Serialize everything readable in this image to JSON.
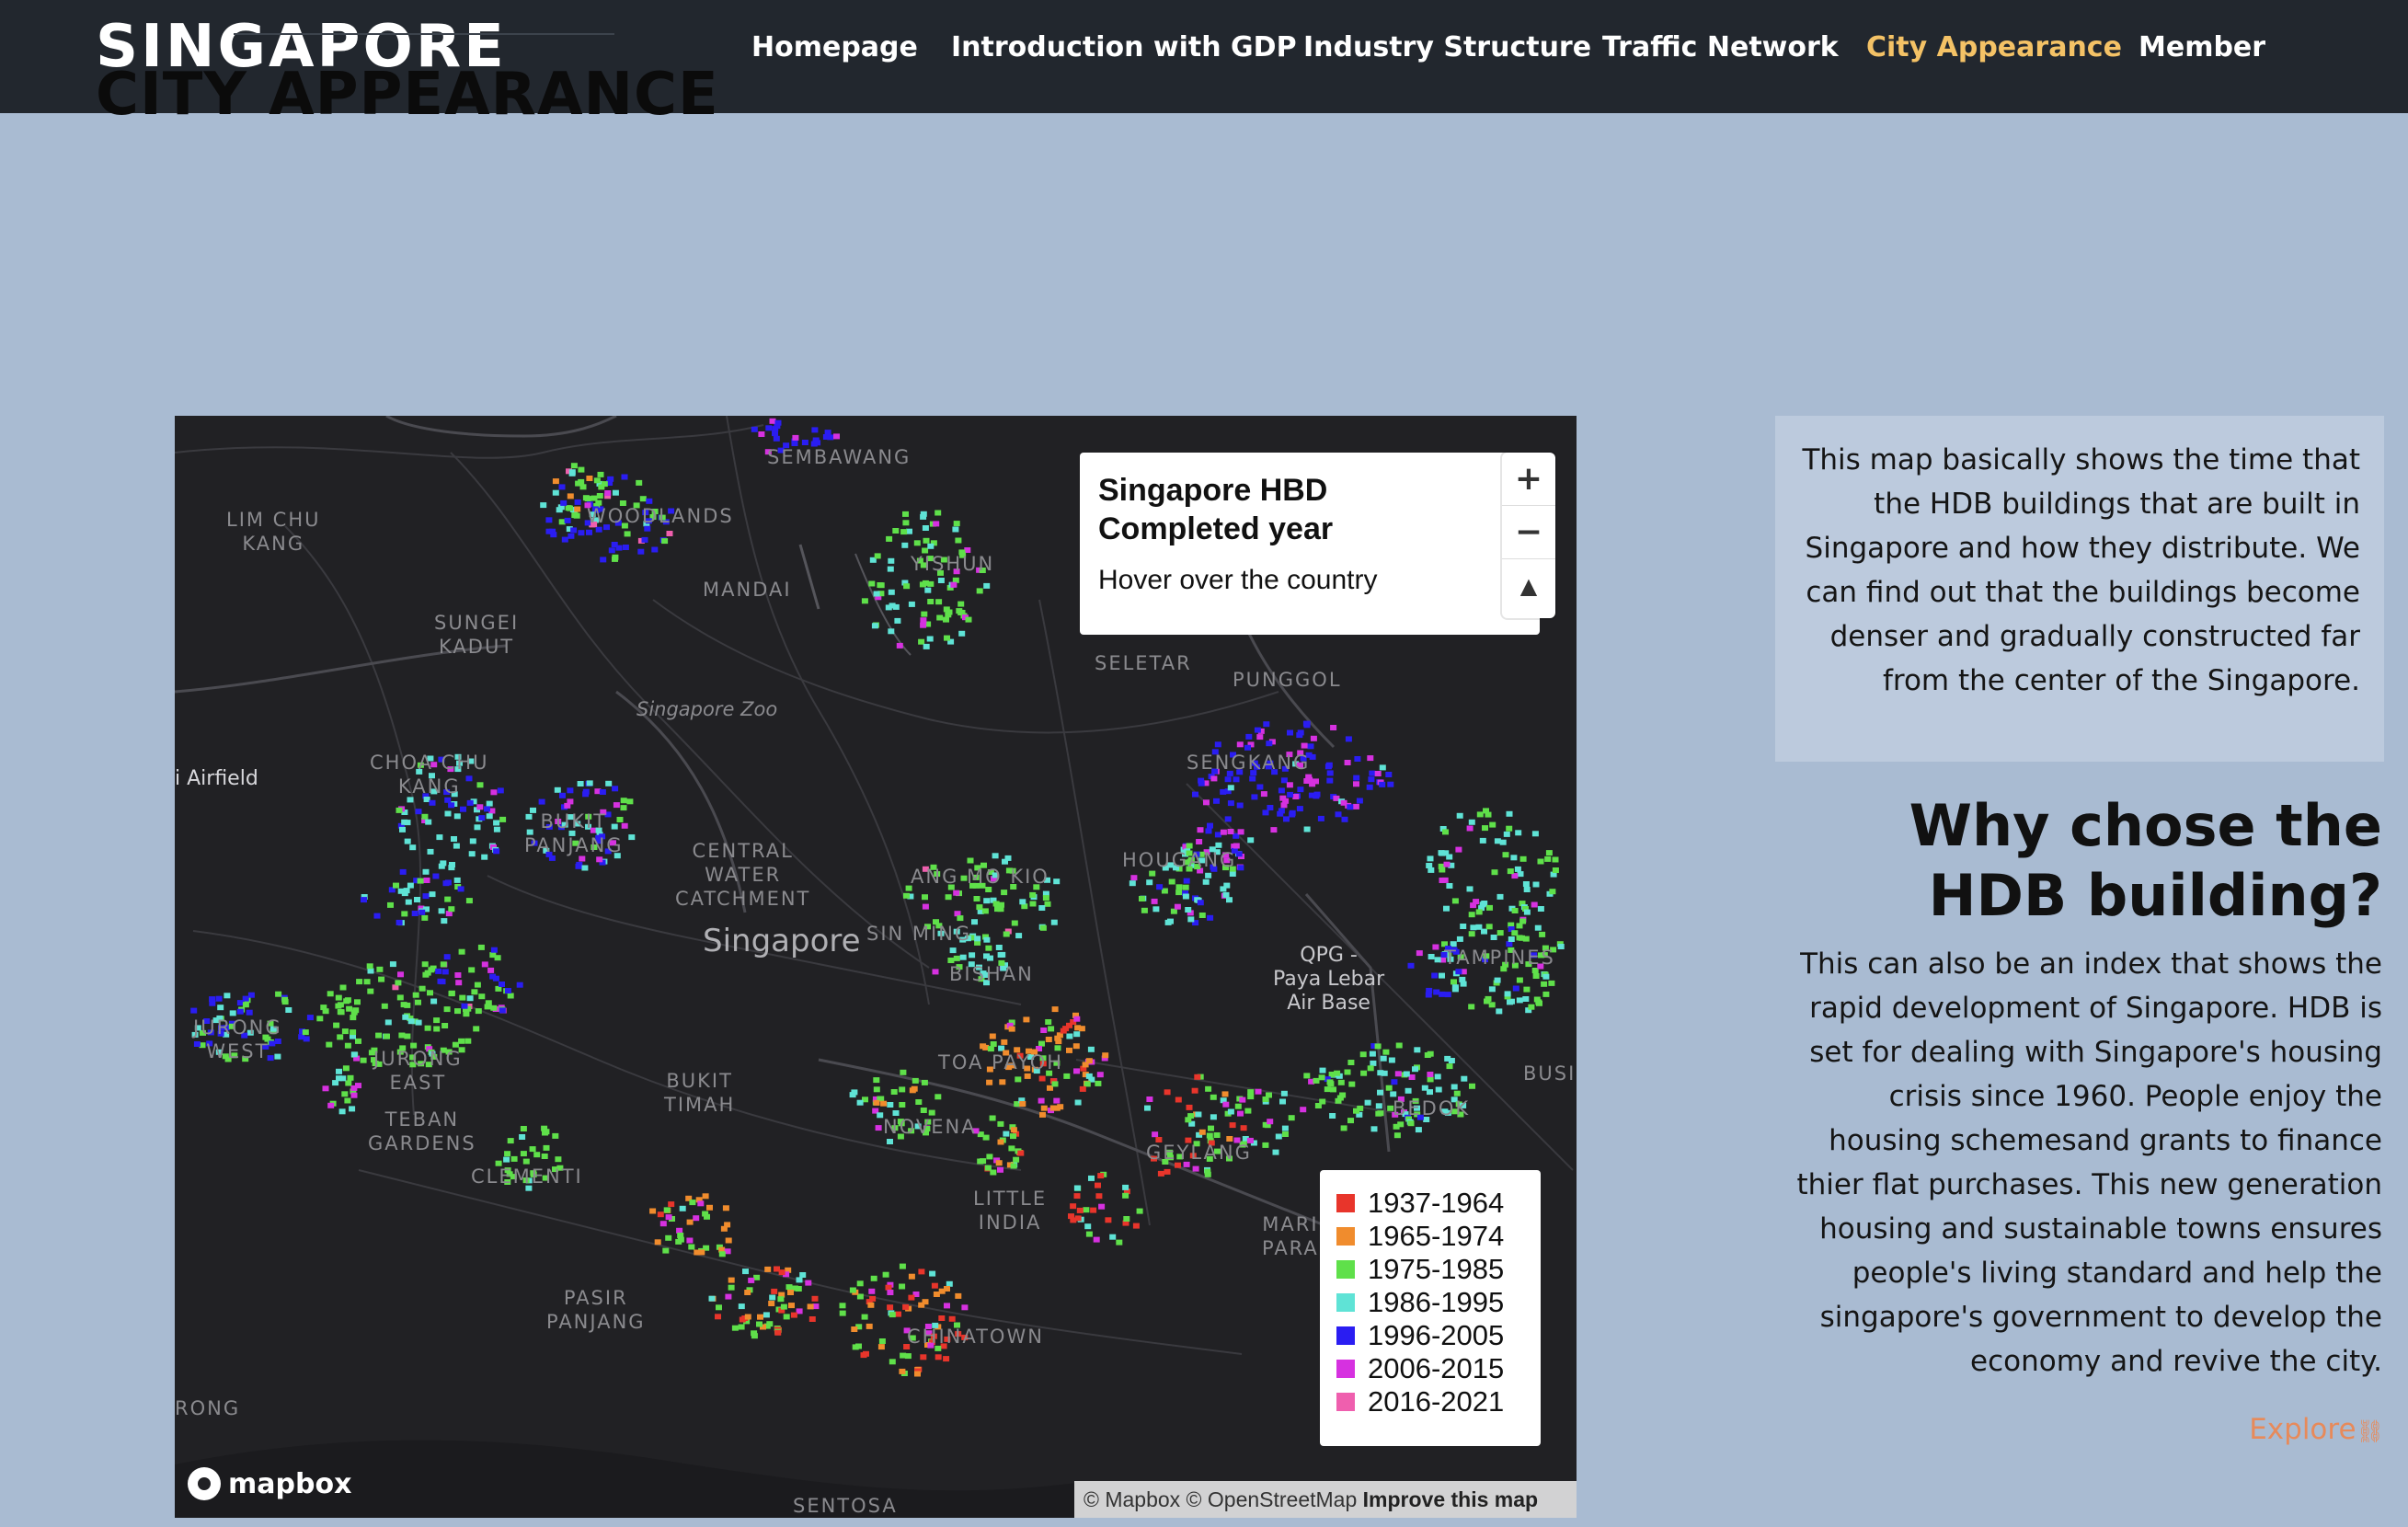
{
  "brand": {
    "line1": "SINGAPORE",
    "line2": "CITY APPEARANCE"
  },
  "nav": {
    "items": [
      {
        "label": "Homepage",
        "active": false
      },
      {
        "label": "Introduction with GDP",
        "active": false
      },
      {
        "label": "Industry Structure",
        "active": false
      },
      {
        "label": "Traffic Network",
        "active": false
      },
      {
        "label": "City Appearance",
        "active": true
      },
      {
        "label": "Member",
        "active": false
      }
    ]
  },
  "map": {
    "info": {
      "title": "Singapore HBD Completed year",
      "hint": "Hover over the country"
    },
    "controls": {
      "zoom_in": "+",
      "zoom_out": "−",
      "compass": "▲"
    },
    "legend": [
      {
        "label": "1937-1964",
        "color": "#e8352b"
      },
      {
        "label": "1965-1974",
        "color": "#f08c2d"
      },
      {
        "label": "1975-1985",
        "color": "#5fe04a"
      },
      {
        "label": "1986-1995",
        "color": "#5fe3d6"
      },
      {
        "label": "1996-2005",
        "color": "#2a1df2"
      },
      {
        "label": "2006-2015",
        "color": "#d631e0"
      },
      {
        "label": "2016-2021",
        "color": "#ef5fae"
      }
    ],
    "places": {
      "sembawang": "SEMBAWANG",
      "lim_chu_kang": "LIM CHU\nKANG",
      "woodlands": "WOODLANDS",
      "yishun": "YISHUN",
      "mandai": "MANDAI",
      "sungei_kadut": "SUNGEI\nKADUT",
      "seletar": "SELETAR",
      "punggol": "PUNGGOL",
      "sengkang": "SENGKANG",
      "singapore_zoo": "Singapore Zoo",
      "airfield": "i Airfield",
      "choa_chu_kang": "CHOA CHU\nKANG",
      "bukit_panjang": "BUKIT\nPANJANG",
      "central_water_catchment": "CENTRAL\nWATER\nCATCHMENT",
      "ang_mo_kio": "ANG MO KIO",
      "hougang": "HOUGANG",
      "singapore": "Singapore",
      "sin_ming": "SIN MING",
      "bishan": "BISHAN",
      "qpg": "QPG -\nPaya Lebar\nAir Base",
      "tampines": "TAMPINES",
      "jurong_west": "JURONG\nWEST",
      "jurong_east": "JURONG\nEAST",
      "teban_gardens": "TEBAN\nGARDENS",
      "bukit_timah": "BUKIT\nTIMAH",
      "novena": "NOVENA",
      "toa_payoh": "TOA PAYOH",
      "bedok": "BEDOK",
      "busi": "BUSI",
      "clementi": "CLEMENTI",
      "geylang": "GEYLANG",
      "little_india": "LITTLE\nINDIA",
      "marine_parade": "MARI\nPARA",
      "pasir_panjang": "PASIR\nPANJANG",
      "chinatown": "CHINATOWN",
      "rong": "RONG",
      "sentosa": "SENTOSA"
    },
    "logo": "mapbox",
    "attribution": {
      "text": "© Mapbox © OpenStreetMap",
      "link": "Improve this map"
    }
  },
  "description": "This map basically shows the time that the HDB buildings that are built in Singapore and how they distribute. We can find out that the buildings become denser and gradually constructed far from the center of the Singapore.",
  "why": {
    "title": "Why chose the HDB building?",
    "body": "This can also be an index that shows the rapid development of Singapore. HDB is set for dealing with Singapore's housing crisis since 1960. People enjoy the housing schemesand grants to finance thier flat purchases. This new generation housing and sustainable towns ensures people's living standard and help the singapore's government to develop the economy and revive the city."
  },
  "explore": {
    "label": "Explore",
    "icon": "link-icon"
  }
}
